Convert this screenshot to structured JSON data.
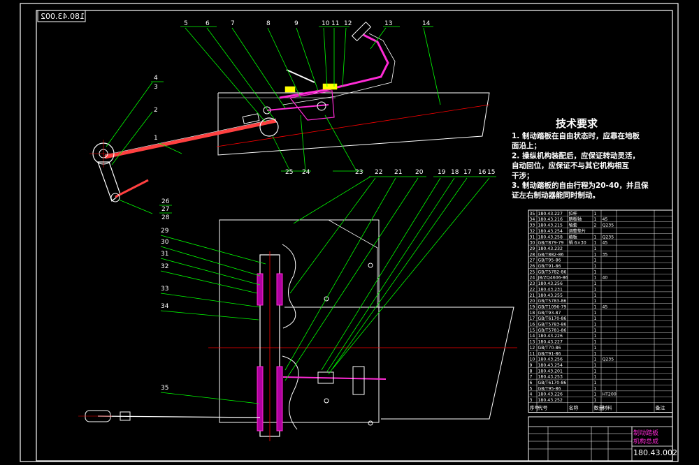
{
  "drawing": {
    "code": "180.43.002",
    "code_mirrored": "180.43.002",
    "title_lines": [
      "制动踏板",
      "机构总成"
    ]
  },
  "tech_req": {
    "heading": "技术要求",
    "items": [
      "1. 制动踏板在自由状态时，应靠在地板",
      "   面沿上；",
      "2. 操纵机构装配后，应保证转动灵活，",
      "   自动回位，应保证不与其它机构相互",
      "   干涉；",
      "3. 制动踏板的自由行程为20-40，并且保",
      "   证左右制动器能同时制动。"
    ]
  },
  "callouts_top": [
    "5",
    "6",
    "7",
    "8",
    "9",
    "10",
    "11",
    "12",
    "13",
    "14"
  ],
  "callouts_left_upper": [
    "4",
    "3",
    "2",
    "1"
  ],
  "callouts_left_lower": [
    "26",
    "27",
    "28"
  ],
  "callouts_mid": [
    "25",
    "24",
    "23",
    "22",
    "21",
    "20",
    "19",
    "18",
    "17",
    "16",
    "15"
  ],
  "callouts_section": [
    "29",
    "30",
    "31",
    "32",
    "33",
    "34",
    "35"
  ],
  "bom_rows": [
    [
      "35",
      "180.43.227",
      "拉杆",
      "1",
      "",
      "",
      ""
    ],
    [
      "34",
      "180.43.216",
      "踏板轴",
      "1",
      "45",
      "",
      ""
    ],
    [
      "33",
      "180.43.215",
      "轴套",
      "2",
      "Q235",
      "",
      ""
    ],
    [
      "32",
      "180.43.254",
      "调整垫片",
      "",
      "",
      "",
      ""
    ],
    [
      "31",
      "180.43.258",
      "踏板",
      "1",
      "Q235",
      "",
      ""
    ],
    [
      "30",
      "GB/T879-79",
      "销 6×30",
      "1",
      "45",
      "",
      ""
    ],
    [
      "29",
      "180.43.232",
      "",
      "1",
      "",
      "",
      ""
    ],
    [
      "28",
      "GB/T882-86",
      "",
      "1",
      "35",
      "",
      ""
    ],
    [
      "27",
      "GB/T95-86",
      "",
      "1",
      "",
      "",
      ""
    ],
    [
      "26",
      "GB/T91-86",
      "",
      "1",
      "",
      "",
      ""
    ],
    [
      "25",
      "GB/T5782-86",
      "",
      "1",
      "",
      "",
      ""
    ],
    [
      "24",
      "JB/ZQ4606-86",
      "",
      "1",
      "40",
      "",
      ""
    ],
    [
      "23",
      "180.43.256",
      "",
      "1",
      "",
      "",
      ""
    ],
    [
      "22",
      "180.43.231",
      "",
      "1",
      "",
      "",
      ""
    ],
    [
      "21",
      "180.43.255",
      "",
      "1",
      "",
      "",
      ""
    ],
    [
      "20",
      "GB/T5783-86",
      "",
      "1",
      "",
      "",
      ""
    ],
    [
      "19",
      "GB/T1096-79",
      "",
      "1",
      "45",
      "",
      ""
    ],
    [
      "18",
      "GB/T93-87",
      "",
      "1",
      "",
      "",
      ""
    ],
    [
      "17",
      "GB/T6170-86",
      "",
      "1",
      "",
      "",
      ""
    ],
    [
      "16",
      "GB/T5783-86",
      "",
      "1",
      "",
      "",
      ""
    ],
    [
      "15",
      "GB/T5781-86",
      "",
      "1",
      "",
      "",
      ""
    ],
    [
      "14",
      "180.43.226",
      "",
      "1",
      "",
      "",
      ""
    ],
    [
      "13",
      "180.43.227",
      "",
      "1",
      "",
      "",
      ""
    ],
    [
      "12",
      "GB/T70-86",
      "",
      "1",
      "",
      "",
      ""
    ],
    [
      "11",
      "GB/T91-86",
      "",
      "1",
      "",
      "",
      ""
    ],
    [
      "10",
      "180.43.256",
      "",
      "1",
      "Q235",
      "",
      ""
    ],
    [
      "9",
      "180.43.254",
      "",
      "1",
      "",
      "",
      ""
    ],
    [
      "8",
      "180.43.201",
      "",
      "1",
      "",
      "",
      ""
    ],
    [
      "7",
      "180.43.253",
      "",
      "1",
      "",
      "",
      ""
    ],
    [
      "6",
      "GB/T6170-86",
      "",
      "1",
      "",
      "",
      ""
    ],
    [
      "5",
      "GB/T95-86",
      "",
      "1",
      "",
      "",
      ""
    ],
    [
      "4",
      "180.43.226",
      "",
      "1",
      "HT200",
      "",
      ""
    ],
    [
      "3",
      "180.43.252",
      "",
      "1",
      "",
      "",
      ""
    ]
  ],
  "bom_header": [
    "序号",
    "代号",
    "名称",
    "数量",
    "材料",
    "",
    "备注"
  ],
  "bom_aside_top": [
    "35",
    "45",
    "Q235",
    "",
    "Q235",
    "45",
    "",
    "35",
    "",
    "",
    "",
    "",
    "",
    "",
    "",
    "",
    "",
    "",
    "",
    "",
    "",
    "",
    "",
    "",
    "",
    "",
    "",
    "",
    "",
    "",
    "",
    "",
    ""
  ],
  "colors": {
    "frame": "#ffffff",
    "outline": "#e6e6e6",
    "leader": "#00ff00",
    "center": "#ff0000",
    "pink": "#ff2bd6",
    "magenta_fill": "#b000a0",
    "yellow": "#ffff00",
    "cyan": "#00ffff"
  }
}
